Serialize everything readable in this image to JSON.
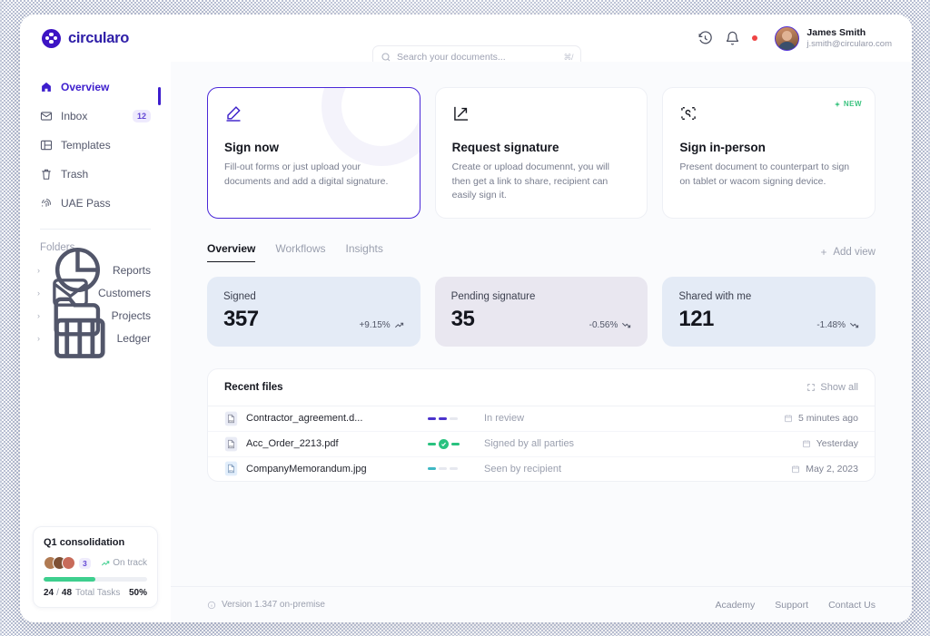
{
  "brand": {
    "name": "circularo",
    "icon": "circularo-logo-icon"
  },
  "search": {
    "placeholder": "Search your documents...",
    "value": "",
    "shortcut": "⌘/",
    "icon": "search-icon"
  },
  "topbar": {
    "history_icon": "history-clock-icon",
    "bell_icon": "bell-icon",
    "notification_dot": "notification-dot",
    "user": {
      "name": "James Smith",
      "email": "j.smith@circularo.com",
      "avatar": "user-avatar"
    }
  },
  "sidebar": {
    "items": [
      {
        "label": "Overview",
        "icon": "home-icon",
        "active": true,
        "badge": ""
      },
      {
        "label": "Inbox",
        "icon": "inbox-mail-icon",
        "active": false,
        "badge": "12"
      },
      {
        "label": "Templates",
        "icon": "templates-grid-icon",
        "active": false,
        "badge": ""
      },
      {
        "label": "Trash",
        "icon": "trash-icon",
        "active": false,
        "badge": ""
      },
      {
        "label": "UAE Pass",
        "icon": "fingerprint-icon",
        "active": false,
        "badge": ""
      }
    ],
    "folders_label": "Folders",
    "folders": [
      {
        "label": "Reports",
        "icon": "pie-chart-icon"
      },
      {
        "label": "Customers",
        "icon": "envelope-icon"
      },
      {
        "label": "Projects",
        "icon": "folder-icon"
      },
      {
        "label": "Ledger",
        "icon": "book-icon"
      }
    ],
    "project_card": {
      "title": "Q1 consolidation",
      "avatar_count": "3",
      "status": "On track",
      "status_icon": "trend-up-icon",
      "progress_percent": 50,
      "completed": "24",
      "separator": "/",
      "total": "48",
      "tasks_label": "Total Tasks",
      "percent_label": "50%"
    }
  },
  "main": {
    "action_cards": [
      {
        "title": "Sign now",
        "desc": "Fill-out forms or just upload your documents and add a digital signature.",
        "icon": "pen-signature-icon",
        "selected": true,
        "badge": ""
      },
      {
        "title": "Request signature",
        "desc": "Create or upload documennt, you will then get a link to share, recipient can easily sign it.",
        "icon": "share-arrow-icon",
        "selected": false,
        "badge": ""
      },
      {
        "title": "Sign in-person",
        "desc": "Present document to counterpart to sign on tablet or wacom signing device.",
        "icon": "scan-signature-icon",
        "selected": false,
        "badge": "NEW"
      }
    ],
    "tabs": [
      {
        "label": "Overview",
        "active": true
      },
      {
        "label": "Workflows",
        "active": false
      },
      {
        "label": "Insights",
        "active": false
      }
    ],
    "add_view": {
      "label": "Add view",
      "icon": "plus-icon"
    },
    "stats": [
      {
        "label": "Signed",
        "value": "357",
        "delta": "+9.15%",
        "delta_icon": "trend-up-icon",
        "bg": "#e4ebf6"
      },
      {
        "label": "Pending signature",
        "value": "35",
        "delta": "-0.56%",
        "delta_icon": "trend-down-icon",
        "bg": "#e9e7f0"
      },
      {
        "label": "Shared with me",
        "value": "121",
        "delta": "-1.48%",
        "delta_icon": "trend-down-icon",
        "bg": "#e4ebf6"
      }
    ],
    "recent": {
      "title": "Recent files",
      "show_all": {
        "label": "Show all",
        "icon": "expand-icon"
      },
      "files": [
        {
          "name": "Contractor_agreement.d...",
          "type": "PDF",
          "status": "In review",
          "date": "5 minutes ago",
          "progress_steps": 2,
          "color": "#4b33cc"
        },
        {
          "name": "Acc_Order_2213.pdf",
          "type": "PDF",
          "status": "Signed by all parties",
          "date": "Yesterday",
          "progress_steps": 3,
          "color": "#29c27f"
        },
        {
          "name": "CompanyMemorandum.jpg",
          "type": "JPG",
          "status": "Seen by recipient",
          "date": "May 2, 2023",
          "progress_steps": 1,
          "color": "#3fb8c4"
        }
      ]
    }
  },
  "footer": {
    "version": "Version 1.347 on-premise",
    "version_icon": "info-icon",
    "links": [
      "Academy",
      "Support",
      "Contact Us"
    ]
  },
  "colors": {
    "brand": "#3d14c4",
    "accent": "#4a28d8",
    "green": "#29c27f",
    "red": "#ef4444"
  }
}
